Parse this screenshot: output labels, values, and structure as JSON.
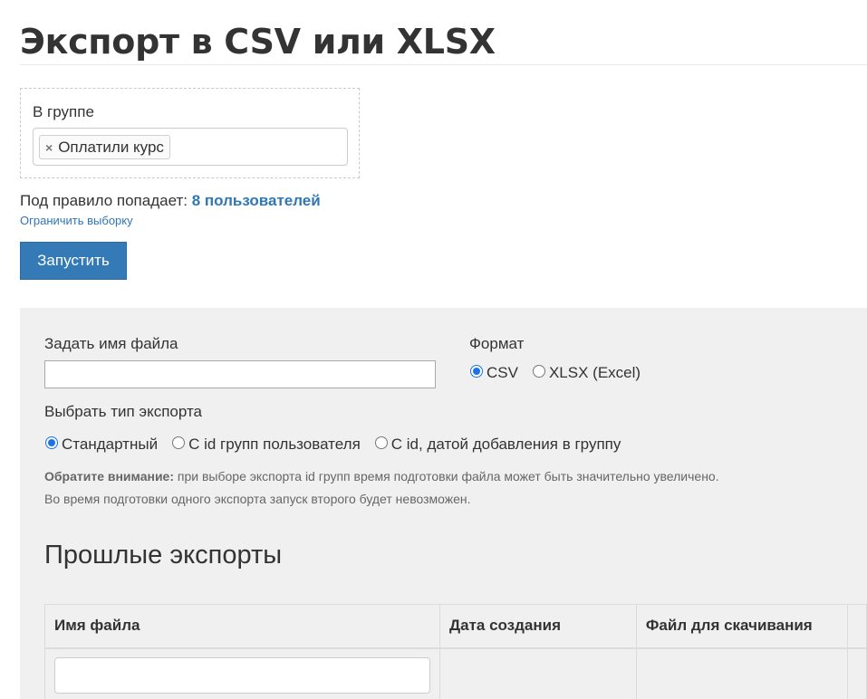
{
  "page": {
    "title": "Экспорт в CSV или XLSX"
  },
  "filter": {
    "label": "В группе",
    "tags": [
      {
        "remove_symbol": "×",
        "label": "Оплатили курс"
      }
    ]
  },
  "rule": {
    "prefix": "Под правило попадает: ",
    "count_text": "8 пользователей",
    "limit_link": "Ограничить выборку"
  },
  "run_button": {
    "label": "Запустить"
  },
  "settings": {
    "filename_label": "Задать имя файла",
    "filename_value": "",
    "format_label": "Формат",
    "format_options": [
      {
        "label": "CSV",
        "checked": true
      },
      {
        "label": "XLSX (Excel)",
        "checked": false
      }
    ],
    "export_type_label": "Выбрать тип экспорта",
    "export_type_options": [
      {
        "label": "Стандартный",
        "checked": true
      },
      {
        "label": "С id групп пользователя",
        "checked": false
      },
      {
        "label": "С id, датой добавления в группу",
        "checked": false
      }
    ],
    "note_bold": "Обратите внимание:",
    "note_text": " при выборе экспорта id групп время подготовки файла может быть значительно увеличено.",
    "note_text2": "Во время подготовки одного экспорта запуск второго будет невозможен."
  },
  "past_exports": {
    "title": "Прошлые экспорты",
    "columns": [
      "Имя файла",
      "Дата создания",
      "Файл для скачивания",
      ""
    ],
    "filter_value": ""
  },
  "colors": {
    "accent": "#337ab7",
    "link": "#2f77b5",
    "panel_bg": "#f0f0f0",
    "radio_checked": "#1a73e8"
  }
}
